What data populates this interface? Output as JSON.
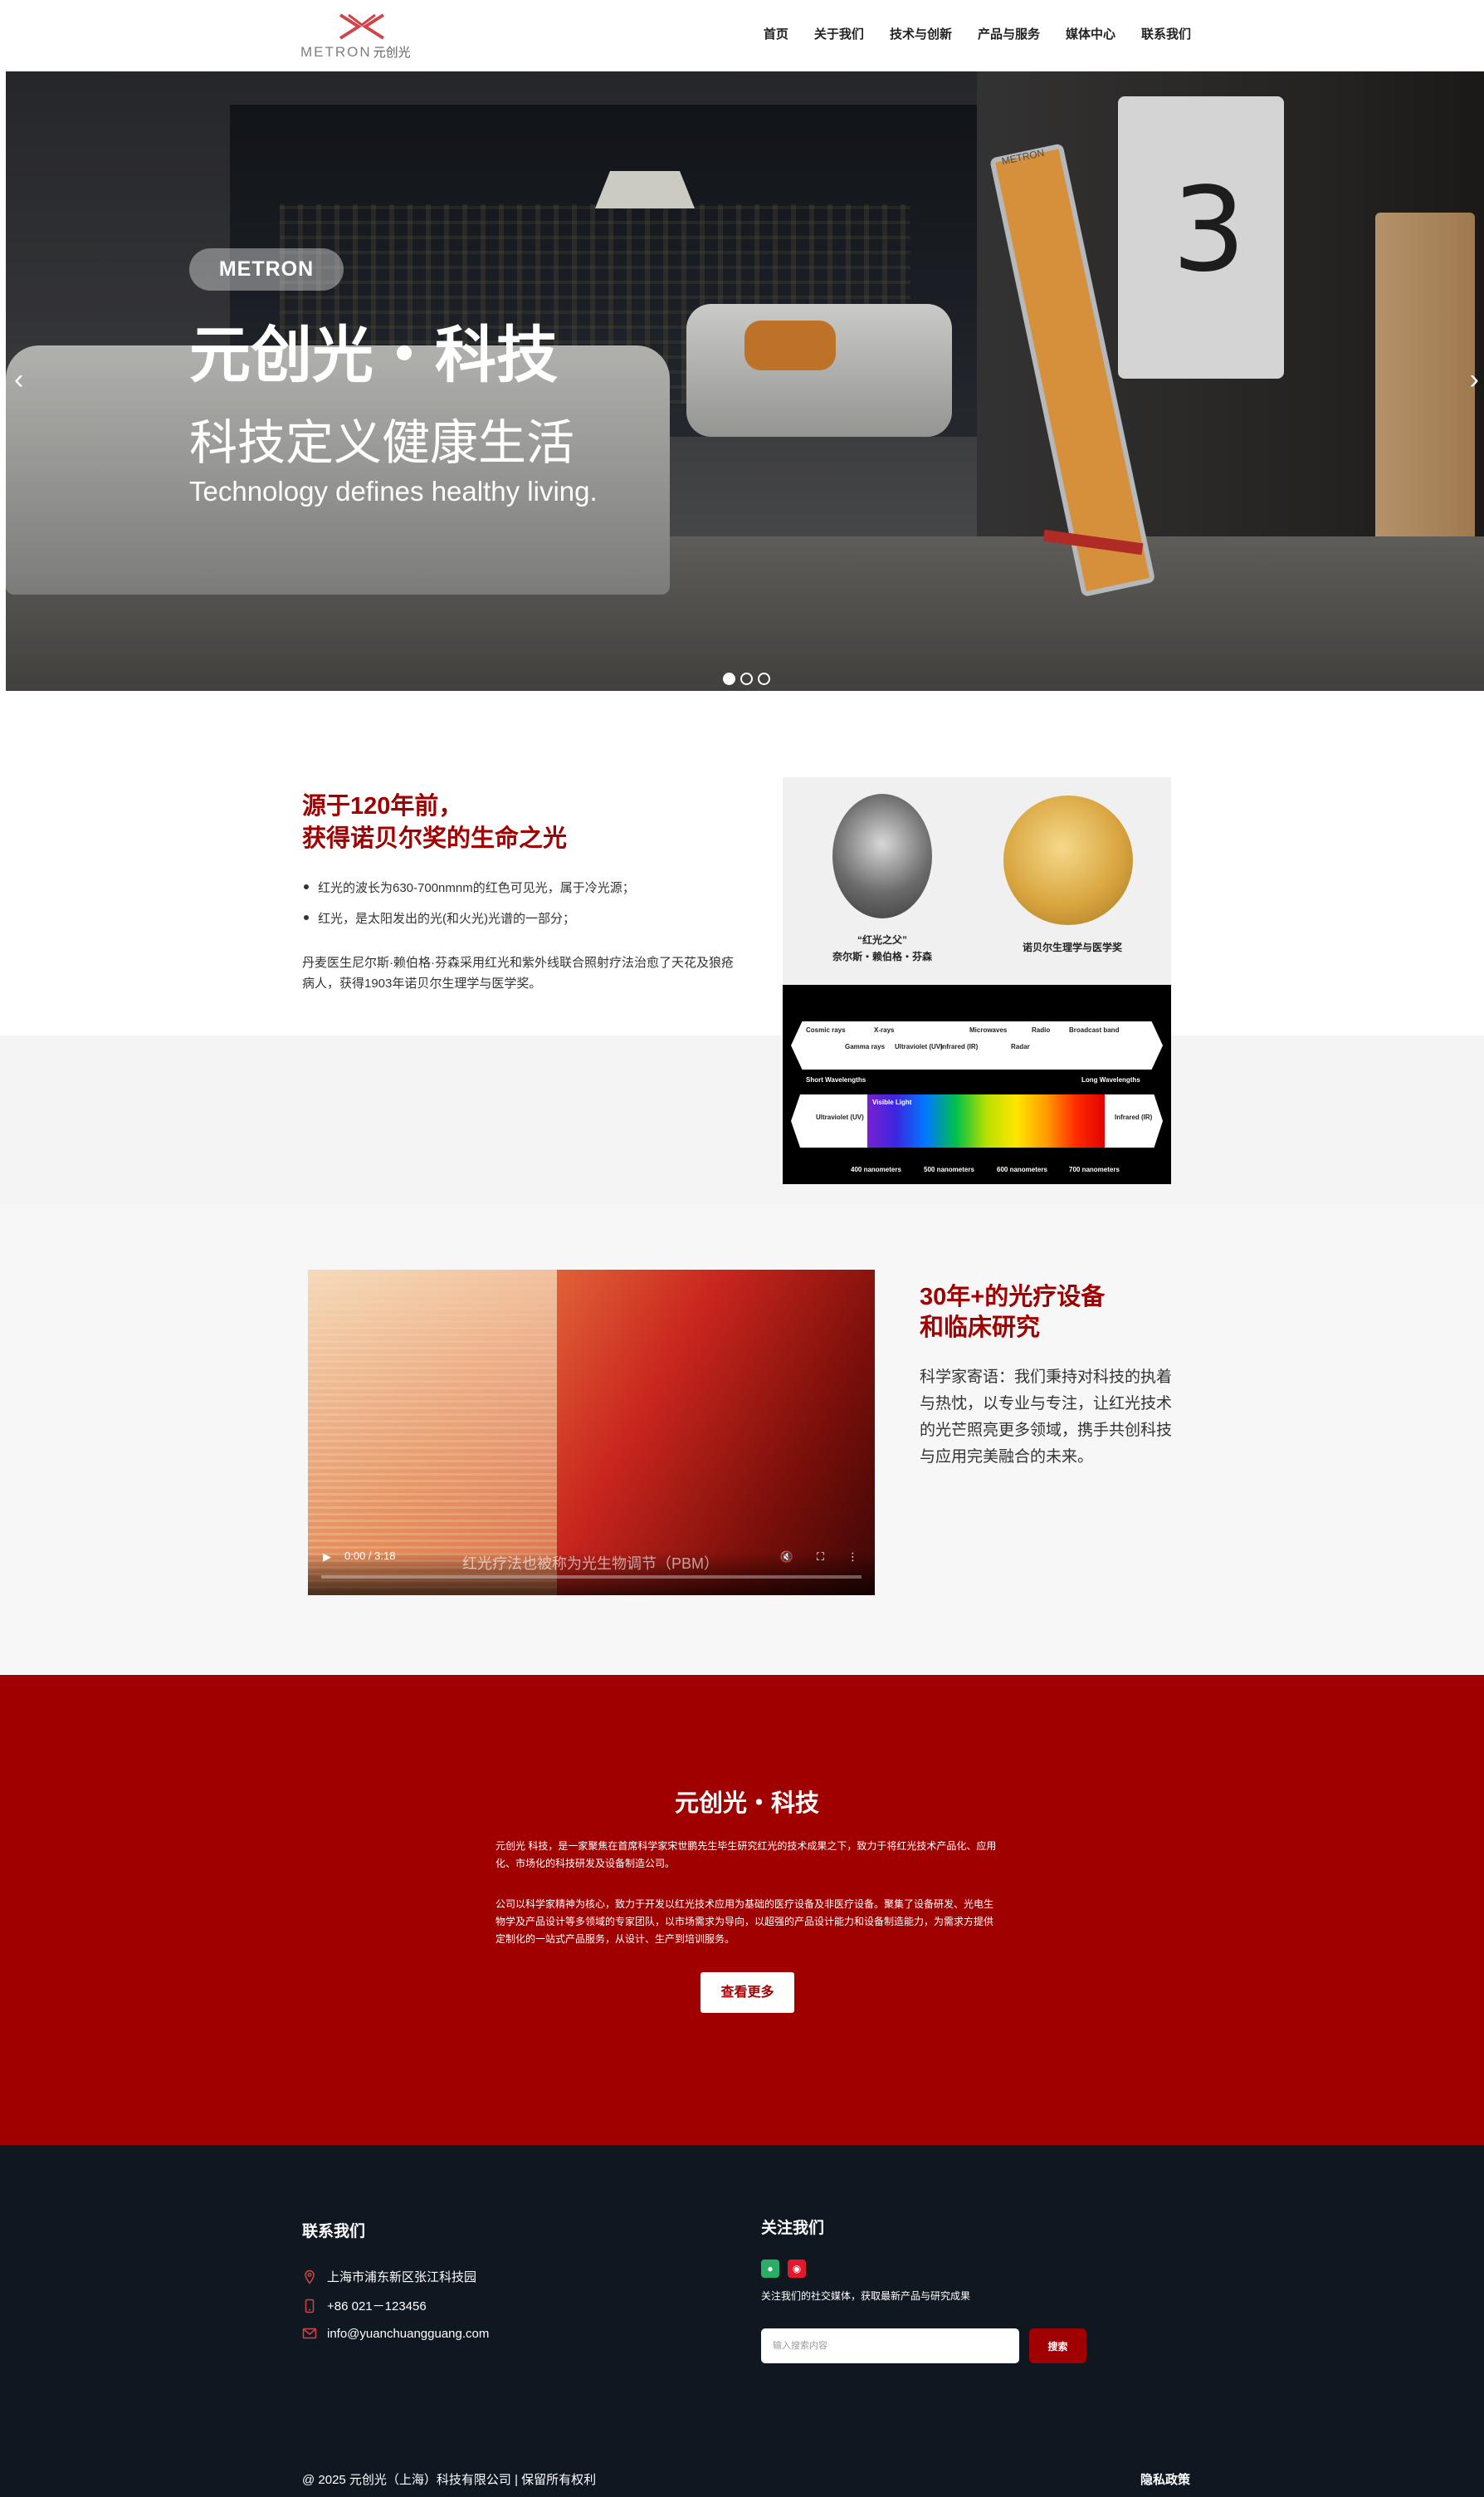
{
  "header": {
    "logo_text": "METRON",
    "logo_cn": "元创光",
    "nav": [
      {
        "label": "首页"
      },
      {
        "label": "关于我们"
      },
      {
        "label": "技术与创新"
      },
      {
        "label": "产品与服务"
      },
      {
        "label": "媒体中心"
      },
      {
        "label": "联系我们"
      }
    ]
  },
  "hero": {
    "badge": "METRON",
    "title": "元创光・科技",
    "subtitle": "科技定义健康生活",
    "english": "Technology defines healthy living.",
    "prev_icon": "chevron-left",
    "next_icon": "chevron-right",
    "slides_total": 3,
    "slide_active": 1,
    "scene": {
      "device_label": "METRON",
      "screen_number": "3"
    }
  },
  "section1": {
    "title_line1": "源于120年前，",
    "title_line2": "获得诺贝尔奖的生命之光",
    "bullets": [
      "红光的波长为630-700nmnm的红色可见光，属于冷光源；",
      "红光，是太阳发出的光(和火光)光谱的一部分；"
    ],
    "paragraph": "丹麦医生尼尔斯·赖伯格·芬森采用红光和紫外线联合照射疗法治愈了天花及狼疮病人，获得1903年诺贝尔生理学与医学奖。",
    "figure": {
      "caption_person_line1": "“红光之父”",
      "caption_person_line2": "奈尔斯・赖伯格・芬森",
      "caption_medal": "诺贝尔生理学与医学奖",
      "spectrum_labels": {
        "cosmic": "Cosmic rays",
        "gamma": "Gamma rays",
        "xrays": "X-rays",
        "uv": "Ultraviolet (UV)",
        "ir": "Infrared (IR)",
        "microwaves": "Microwaves",
        "radar": "Radar",
        "radio": "Radio",
        "broadcast": "Broadcast band",
        "short": "Short Wavelengths",
        "long": "Long Wavelengths",
        "visible": "Visible Light",
        "uv2": "Ultraviolet (UV)",
        "ir2": "Infrared (IR)",
        "nm400": "400 nanometers",
        "nm500": "500 nanometers",
        "nm600": "600 nanometers",
        "nm700": "700 nanometers"
      }
    }
  },
  "section2": {
    "title_line1": "30年+的光疗设备",
    "title_line2": "和临床研究",
    "text": "科学家寄语：我们秉持对科技的执着与热忱，以专业与专注，让红光技术的光芒照亮更多领域，携手共创科技与应用完美融合的未来。",
    "video": {
      "time": "0:00 / 3:18",
      "progress_pct": 0,
      "caption": "红光疗法也被称为光生物调节（PBM）"
    }
  },
  "about": {
    "title": "元创光・科技",
    "p1": "元创光 科技，是一家聚焦在首席科学家宋世鹏先生毕生研究红光的技术成果之下，致力于将红光技术产品化、应用化、市场化的科技研发及设备制造公司。",
    "p2": "公司以科学家精神为核心，致力于开发以红光技术应用为基础的医疗设备及非医疗设备。聚集了设备研发、光电生物学及产品设计等多领域的专家团队，以市场需求为导向，以超强的产品设计能力和设备制造能力，为需求方提供定制化的一站式产品服务，从设计、生产到培训服务。",
    "button": "查看更多"
  },
  "footer": {
    "contact_title": "联系我们",
    "address": "上海市浦东新区张江科技园",
    "phone": "+86 021－123456",
    "email": "info@yuanchuangguang.com",
    "follow_title": "关注我们",
    "follow_text": "关注我们的社交媒体，获取最新产品与研究成果",
    "search_placeholder": "输入搜索内容",
    "search_button": "搜索",
    "copyright": "@ 2025 元创光（上海）科技有限公司 | 保留所有权利",
    "privacy": "隐私政策"
  },
  "colors": {
    "brand_red": "#a00000",
    "footer_bg": "#0f1720",
    "wechat": "#2aae67",
    "weibo": "#e6162d"
  }
}
